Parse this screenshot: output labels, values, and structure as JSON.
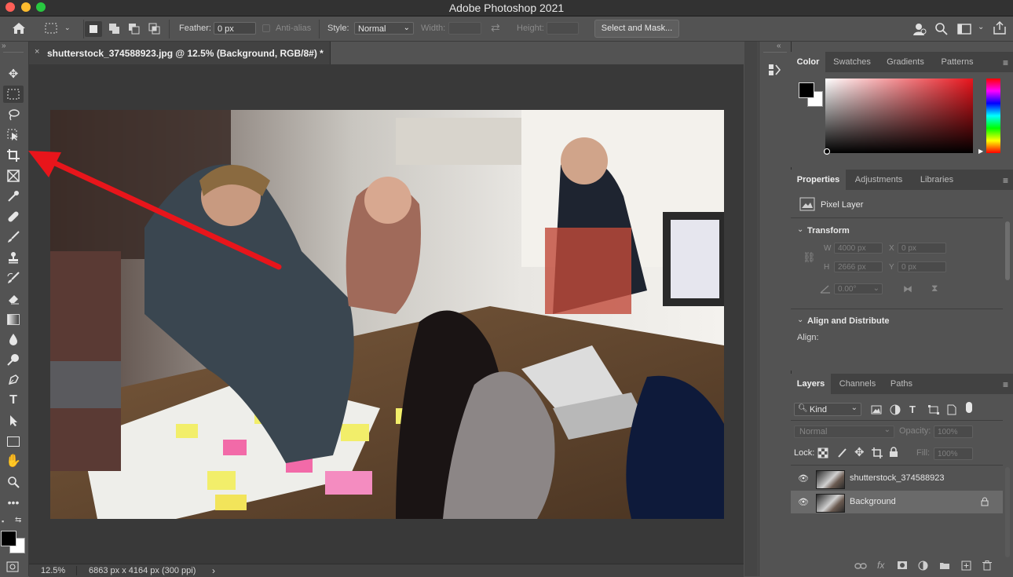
{
  "app": {
    "title": "Adobe Photoshop 2021"
  },
  "options": {
    "feather_label": "Feather:",
    "feather_value": "0 px",
    "antialias_label": "Anti-alias",
    "style_label": "Style:",
    "style_value": "Normal",
    "width_label": "Width:",
    "height_label": "Height:",
    "select_mask": "Select and Mask..."
  },
  "document": {
    "tab_title": "shutterstock_374588923.jpg @ 12.5% (Background, RGB/8#) *",
    "zoom": "12.5%",
    "info": "6863 px x 4164 px (300 ppi)"
  },
  "color_panel": {
    "tabs": [
      "Color",
      "Swatches",
      "Gradients",
      "Patterns"
    ],
    "active": "Color"
  },
  "properties_panel": {
    "tabs": [
      "Properties",
      "Adjustments",
      "Libraries"
    ],
    "layer_type": "Pixel Layer",
    "transform_label": "Transform",
    "w_label": "W",
    "w_value": "4000 px",
    "h_label": "H",
    "h_value": "2666 px",
    "x_label": "X",
    "x_value": "0 px",
    "y_label": "Y",
    "y_value": "0 px",
    "angle_value": "0.00°",
    "align_section": "Align and Distribute",
    "align_label": "Align:"
  },
  "layers_panel": {
    "tabs": [
      "Layers",
      "Channels",
      "Paths"
    ],
    "filter_kind": "Kind",
    "blend_mode": "Normal",
    "opacity_label": "Opacity:",
    "opacity_value": "100%",
    "lock_label": "Lock:",
    "fill_label": "Fill:",
    "fill_value": "100%",
    "layers": [
      {
        "name": "shutterstock_374588923"
      },
      {
        "name": "Background"
      }
    ]
  },
  "tools": {
    "type_tool_glyph": "T"
  },
  "colors": {
    "accent_arrow": "#e8151b",
    "foreground": "#000000",
    "background": "#ffffff"
  }
}
